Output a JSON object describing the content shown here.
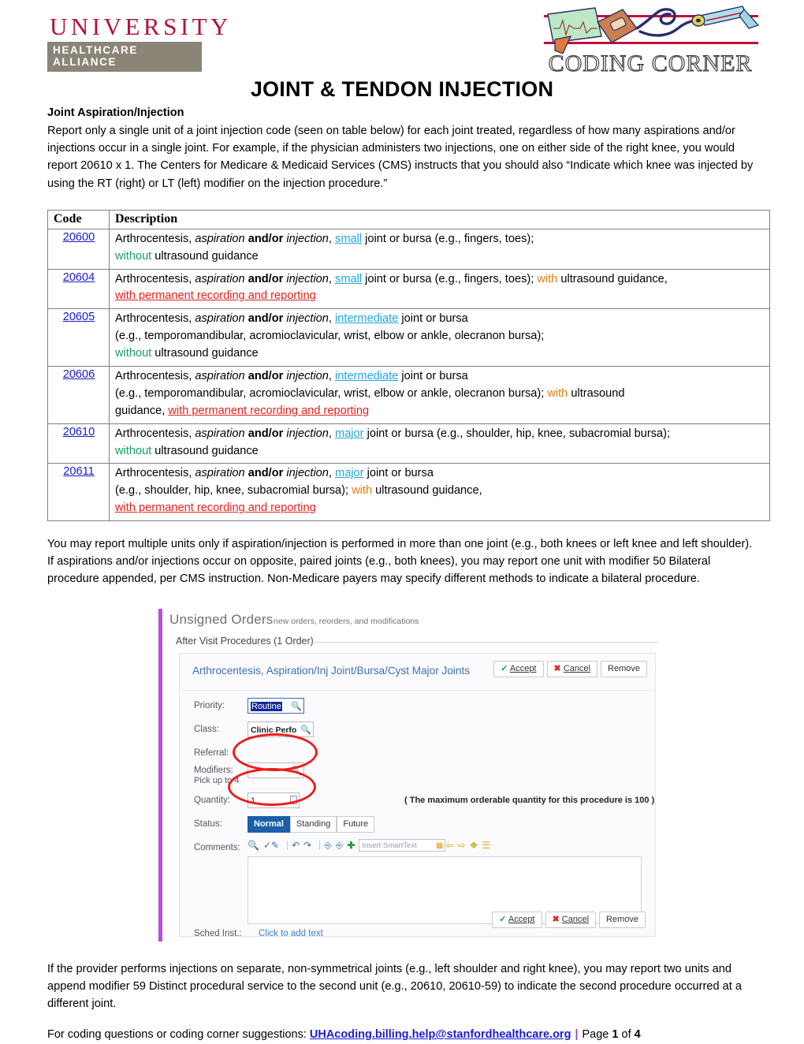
{
  "header": {
    "org_name": "UNIVERSITY",
    "org_sub": "HEALTHCARE ALLIANCE",
    "brand": "CODING CORNER",
    "org_color": "#b4123a",
    "brand_rule_color": "#c2103b"
  },
  "title": "JOINT & TENDON INJECTION",
  "section_heading": "Joint Aspiration/Injection",
  "intro_paragraph": "Report only a single unit of a joint injection code (seen on table below) for each joint treated, regardless of how many aspirations and/or injections occur in a single joint. For example, if the physician administers two injections, one on either side of the right knee, you would report 20610 x 1. The Centers for Medicare & Medicaid Services (CMS) instructs that you should also “Indicate which knee was injected by using the RT (right) or LT (left) modifier on the injection procedure.”",
  "table": {
    "columns": [
      "Code",
      "Description"
    ],
    "rows": [
      {
        "code": "20600",
        "lead": "Arthrocentesis, ",
        "aspiration": "aspiration",
        "andor": " and/or ",
        "injection": "injection",
        "comma": ", ",
        "size": "small",
        "mid": " joint or bursa (e.g., fingers, toes);",
        "line2_kw": "without",
        "line2_kw_type": "without",
        "line2_rest": " ultrasound guidance",
        "line3_kw": "",
        "line3_rest": ""
      },
      {
        "code": "20604",
        "lead": "Arthrocentesis, ",
        "aspiration": "aspiration",
        "andor": " and/or ",
        "injection": "injection",
        "comma": ", ",
        "size": "small",
        "mid": " joint or bursa (e.g., fingers, toes); ",
        "inline_kw": "with",
        "inline_rest": " ultrasound guidance,",
        "line2_kw": "with permanent recording and reporting",
        "line2_kw_type": "permanent",
        "line2_rest": ""
      },
      {
        "code": "20605",
        "lead": "Arthrocentesis, ",
        "aspiration": "aspiration",
        "andor": " and/or ",
        "injection": "injection",
        "comma": ", ",
        "size": "intermediate",
        "mid": " joint or bursa",
        "line2_plain": "(e.g., temporomandibular, acromioclavicular, wrist, elbow or ankle, olecranon bursa);",
        "line3_kw": "without",
        "line3_kw_type": "without",
        "line3_rest": " ultrasound guidance"
      },
      {
        "code": "20606",
        "lead": "Arthrocentesis, ",
        "aspiration": "aspiration",
        "andor": " and/or ",
        "injection": "injection",
        "comma": ", ",
        "size": "intermediate",
        "mid": " joint or bursa",
        "line2_plain": "(e.g., temporomandibular, acromioclavicular, wrist, elbow or ankle, olecranon bursa); ",
        "line2_kw": "with",
        "line2_kw_type": "with",
        "line2_rest": " ultrasound",
        "line3_plain": "guidance, ",
        "line3_kw": "with permanent recording and reporting",
        "line3_kw_type": "permanent"
      },
      {
        "code": "20610",
        "lead": "Arthrocentesis, ",
        "aspiration": "aspiration",
        "andor": " and/or ",
        "injection": "injection",
        "comma": ", ",
        "size": "major",
        "mid": " joint or bursa (e.g., shoulder, hip, knee, subacromial bursa);",
        "line2_kw": "without",
        "line2_kw_type": "without",
        "line2_rest": " ultrasound guidance"
      },
      {
        "code": "20611",
        "lead": "Arthrocentesis, ",
        "aspiration": "aspiration",
        "andor": " and/or ",
        "injection": "injection",
        "comma": ", ",
        "size": "major",
        "mid": " joint or bursa",
        "line2_plain": "(e.g., shoulder, hip, knee, subacromial bursa); ",
        "line2_kw": "with",
        "line2_kw_type": "with",
        "line2_rest": " ultrasound guidance,",
        "line3_kw": "with permanent recording and reporting",
        "line3_kw_type": "permanent"
      }
    ]
  },
  "paragraph_after_table": "You may report multiple units only if aspiration/injection is performed in more than one joint (e.g., both knees or left knee and left shoulder). If aspirations and/or injections occur on opposite, paired joints (e.g., both knees), you may report one unit with modifier 50 Bilateral procedure appended, per CMS instruction. Non-Medicare payers may specify different methods to indicate a bilateral procedure.",
  "screenshot": {
    "unsigned_orders_title": "Unsigned Orders",
    "unsigned_orders_subtitle": "new orders, reorders, and modifications",
    "section": "After Visit Procedures (1 Order)",
    "order_title": "Arthrocentesis, Aspiration/Inj Joint/Bursa/Cyst Major Joints",
    "buttons": {
      "accept": "Accept",
      "cancel": "Cancel",
      "remove": "Remove"
    },
    "fields": {
      "priority_label": "Priority:",
      "priority_value": "Routine",
      "class_label": "Class:",
      "class_value": "Clinic Perfo",
      "referral_label": "Referral:",
      "modifiers_label": "Modifiers:",
      "modifiers_value": "",
      "pick_hint": "Pick up to 4",
      "quantity_label": "Quantity:",
      "quantity_value": "1",
      "quantity_hint": "( The maximum orderable quantity for this procedure is 100 )",
      "status_label": "Status:",
      "status_options": [
        "Normal",
        "Standing",
        "Future"
      ],
      "status_selected": "Normal",
      "comments_label": "Comments:",
      "smarttext_placeholder": "Insert SmartText",
      "sched_label": "Sched Inst.:",
      "sched_link": "Click to add text"
    },
    "annotation_color": "#ee1b18",
    "accent_bar_color": "#b44de0"
  },
  "paragraph_bottom": "If the provider performs injections on separate, non-symmetrical joints (e.g., left shoulder and right knee), you may report two units and append modifier 59 Distinct procedural service to the second unit (e.g., 20610, 20610-59) to indicate the second procedure occurred at a different joint.",
  "footer": {
    "lead": "For coding questions or coding corner suggestions:",
    "email": "UHAcoding.billing.help@stanfordhealthcare.org",
    "separator": "|",
    "page_prefix": "Page",
    "page_number": "1",
    "page_of": "of",
    "page_total": "4"
  }
}
